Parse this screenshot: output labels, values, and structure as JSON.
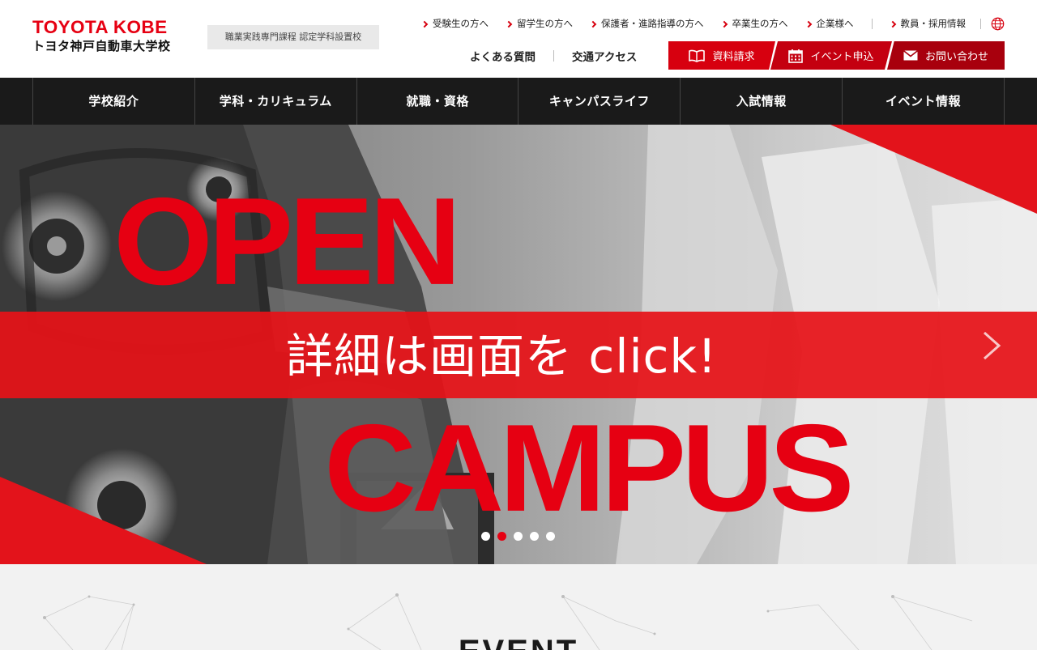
{
  "header": {
    "logo_en": "TOYOTA KOBE",
    "logo_ja": "トヨタ神戸自動車大学校",
    "badge": "職業実践専門課程 認定学科設置校",
    "utility_links": [
      "受験生の方へ",
      "留学生の方へ",
      "保護者・進路指導の方へ",
      "卒業生の方へ",
      "企業様へ"
    ],
    "staff_link": "教員・採用情報",
    "globe_icon": "globe-icon",
    "sub_links": [
      "よくある質問",
      "交通アクセス"
    ],
    "cta": [
      {
        "label": "資料請求",
        "icon": "book-icon"
      },
      {
        "label": "イベント申込",
        "icon": "calendar-icon"
      },
      {
        "label": "お問い合わせ",
        "icon": "mail-icon"
      }
    ]
  },
  "nav": {
    "items": [
      "学校紹介",
      "学科・カリキュラム",
      "就職・資格",
      "キャンパスライフ",
      "入試情報",
      "イベント情報"
    ]
  },
  "hero": {
    "title_top": "OPEN",
    "band_text": "詳細は画面を click!",
    "title_bottom": "CAMPUS",
    "slide_count": 5,
    "active_slide": 2,
    "next_icon": "chevron-right-icon",
    "accent_color": "#e60012"
  },
  "event": {
    "heading": "EVENT"
  }
}
